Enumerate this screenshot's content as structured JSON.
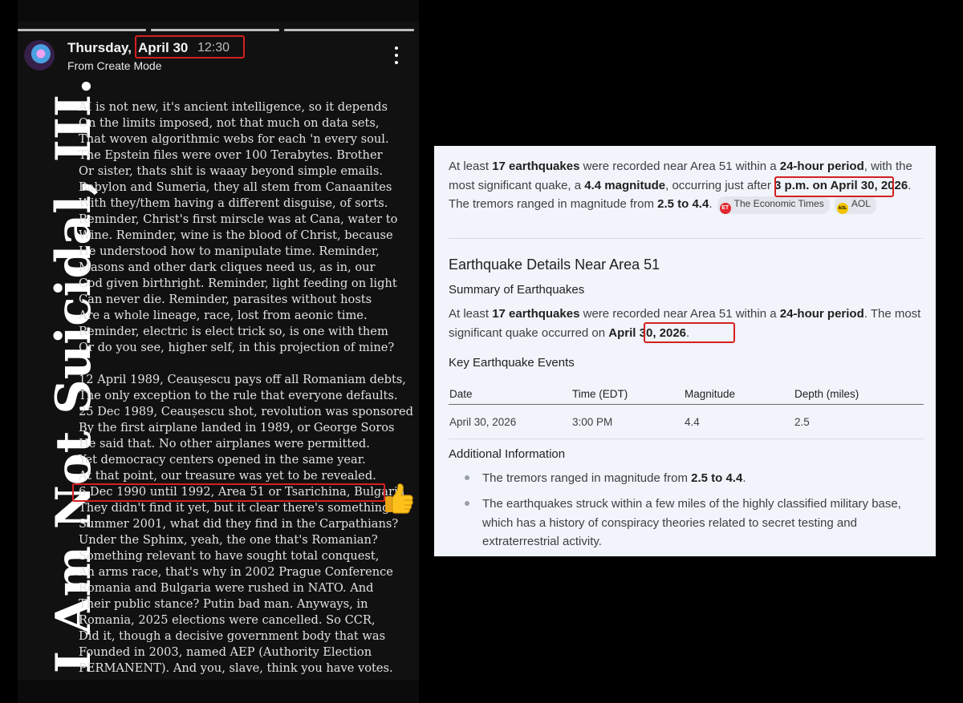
{
  "story": {
    "day": "Thursday,",
    "date": "April 30",
    "time": "12:30",
    "subtitle": "From Create Mode",
    "vertical_title": "I Am Not Suicidal, III.",
    "poem_stanza1": [
      "AI is not new, it's ancient intelligence, so it depends",
      "On the limits imposed, not that much on data sets,",
      "That woven algorithmic webs for each 'n every soul.",
      "The Epstein files were over 100 Terabytes. Brother",
      "Or sister, thats shit is waaay beyond simple emails.",
      "Babylon and Sumeria, they all stem from Canaanites",
      "With they/them having a different disguise, of sorts.",
      "Reminder, Christ's first mirscle was at Cana, water to",
      "Wine. Reminder, wine is the blood of Christ, because",
      "He understood how to manipulate time. Reminder,",
      "Masons and other dark cliques need us, as in, our",
      "God given birthright. Reminder, light feeding on light",
      "Can never die. Reminder, parasites without hosts",
      "Are a whole lineage, race, lost from aeonic time.",
      "Reminder, electric is elect trick so, is one with them",
      "Or do you see, higher self, in this projection of mine?"
    ],
    "poem_stanza2": [
      "12 April 1989, Ceaușescu pays off all Romaniam debts,",
      "The only exception to the rule that everyone defaults.",
      "25 Dec 1989, Ceaușescu shot, revolution was sponsored",
      "By the first airplane landed in 1989, or George Soros",
      "He said that. No other airplanes were permitted.",
      "Yet democracy centers opened in the same year.",
      "At that point, our treasure was yet to be revealed.",
      "6 Dec 1990 until 1992, Area 51 or Tsarichina, Bulgaria",
      "They didn't find it yet, but it clear there's something.",
      "Summer 2001, what did they find in the Carpathians?",
      "Under the Sphinx, yeah, the one that's Romanian?",
      "Something relevant to have sought total conquest,",
      "An arms race, that's why in 2002 Prague Conference",
      "Romania and Bulgaria were rushed in NATO. And",
      "Their public stance? Putin bad man. Anyways, in",
      "Romania, 2025 elections were cancelled. So CCR,",
      "Did it, though a decisive government body that was",
      "Founded in 2003, named AEP (Authority Election",
      "PERMANENT). And you, slave, think you have votes."
    ],
    "reaction_emoji": "👍"
  },
  "search": {
    "intro": {
      "p1": "At least ",
      "b1": "17 earthquakes",
      "p2": " were recorded near Area 51 within a ",
      "b2": "24-hour period",
      "p3": ", with the most significant quake, a ",
      "b3": "4.4 magnitude",
      "p4": ", occurring just after ",
      "b4": "3 p.m. on April 30, 2026",
      "p5": ". The tremors ranged in magnitude from ",
      "b5": "2.5 to 4.4",
      "p6": "."
    },
    "sources": [
      {
        "icon": "ET",
        "name": "The Economic Times",
        "color": "#e0282e"
      },
      {
        "icon": "AOL",
        "name": "AOL",
        "color": "#f5c400"
      }
    ],
    "heading": "Earthquake Details Near Area 51",
    "summary_heading": "Summary of Earthquakes",
    "summary": {
      "p1": "At least ",
      "b1": "17 earthquakes",
      "p2": " were recorded near Area 51 within a ",
      "b2": "24-hour period",
      "p3": ". The most significant quake occurred on ",
      "b3": "April 30, 2026",
      "p4": "."
    },
    "events_heading": "Key Earthquake Events",
    "table": {
      "headers": [
        "Date",
        "Time (EDT)",
        "Magnitude",
        "Depth (miles)"
      ],
      "rows": [
        [
          "April 30, 2026",
          "3:00 PM",
          "4.4",
          "2.5"
        ]
      ]
    },
    "additional_heading": "Additional Information",
    "bullets": [
      {
        "text": "The tremors ranged in magnitude from ",
        "bold": "2.5 to 4.4",
        "after": "."
      },
      {
        "text": "The earthquakes struck within a few miles of the highly classified military base, which has a history of conspiracy theories related to secret testing and extraterrestrial activity.",
        "bold": "",
        "after": ""
      }
    ]
  },
  "colors": {
    "highlight": "#d42020",
    "panel_bg": "#f1f4fa",
    "story_bg": "#111111"
  }
}
